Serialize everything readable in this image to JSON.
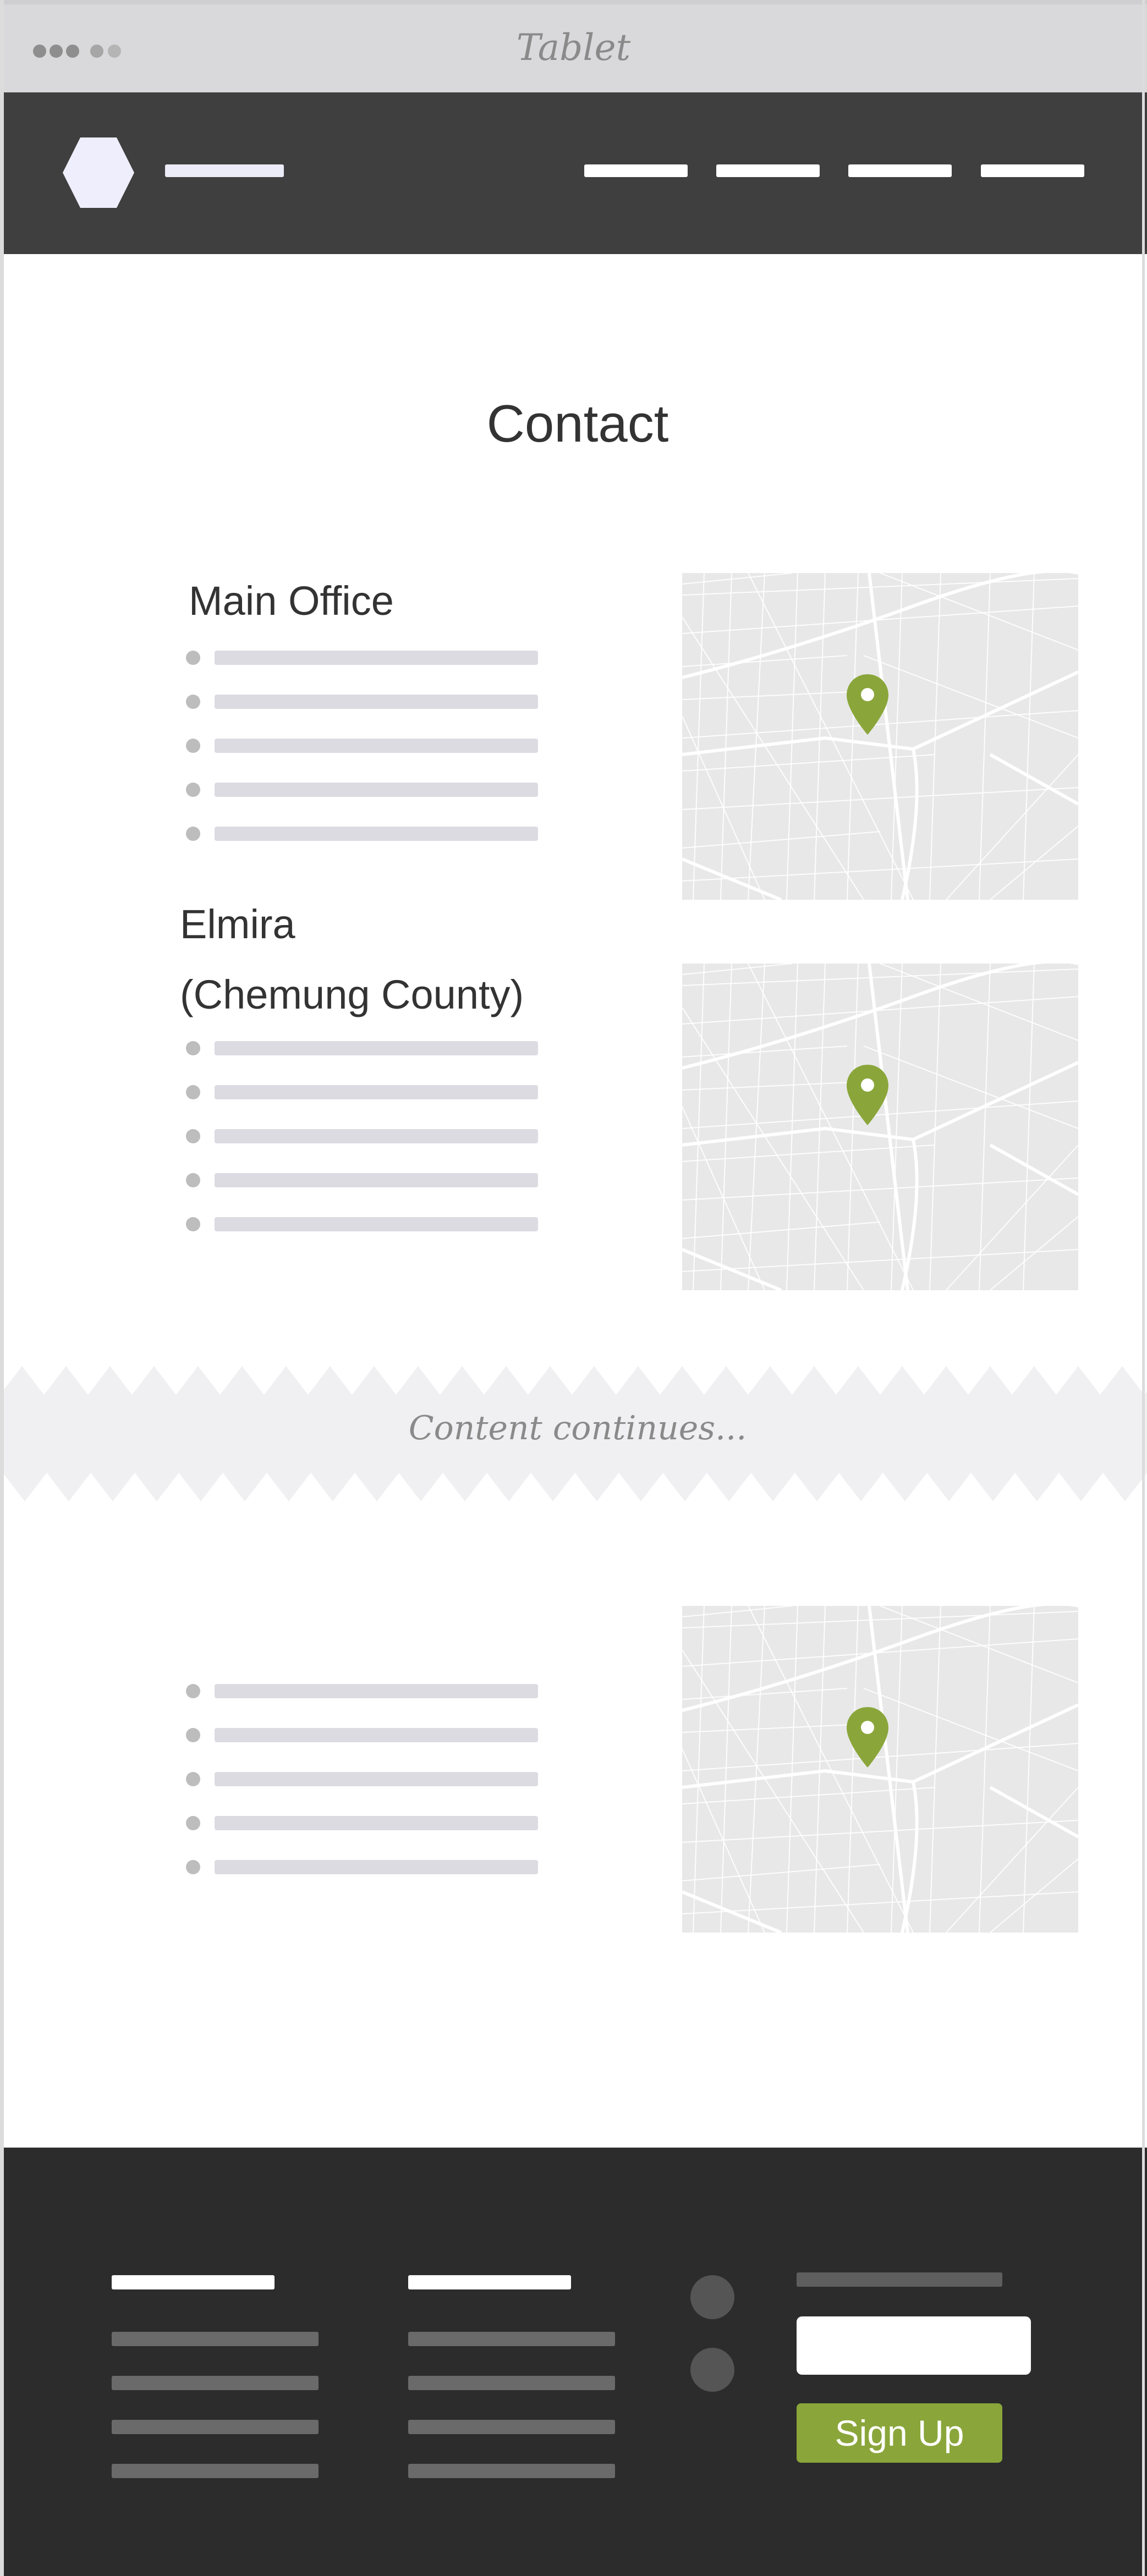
{
  "chrome": {
    "title": "Tablet"
  },
  "page": {
    "title": "Contact"
  },
  "offices": [
    {
      "name": "Main Office"
    },
    {
      "name_line1": "Elmira",
      "name_line2": "(Chemung County)"
    }
  ],
  "divider": {
    "text": "Content continues..."
  },
  "footer": {
    "signup_label": "Sign Up",
    "email_placeholder": ""
  },
  "colors": {
    "header_bg": "#3f3f3f",
    "footer_bg": "#2c2c2c",
    "accent": "#8aa63a",
    "logo": "#efeefc",
    "placeholder_line": "#dcdbe2"
  },
  "icons": {
    "logo": "hexagon-logo-icon",
    "map_pin": "map-pin-icon",
    "social": "social-icon"
  }
}
